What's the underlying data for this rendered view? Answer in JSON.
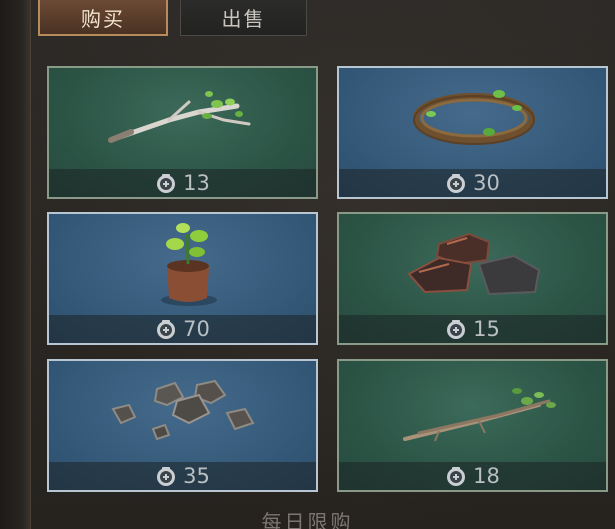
{
  "tabs": {
    "buy": "购买",
    "sell": "出售"
  },
  "items": [
    {
      "name": "branch",
      "price": "13",
      "bg": "green"
    },
    {
      "name": "vine-wreath",
      "price": "30",
      "bg": "blue"
    },
    {
      "name": "sapling",
      "price": "70",
      "bg": "blue"
    },
    {
      "name": "copper-ore",
      "price": "15",
      "bg": "green"
    },
    {
      "name": "iron-ore",
      "price": "35",
      "bg": "blue"
    },
    {
      "name": "twigs",
      "price": "18",
      "bg": "green"
    }
  ],
  "footer": {
    "title": "每日限购"
  },
  "colors": {
    "accent": "#b88b5c",
    "price_text": "#b9bfc2"
  }
}
